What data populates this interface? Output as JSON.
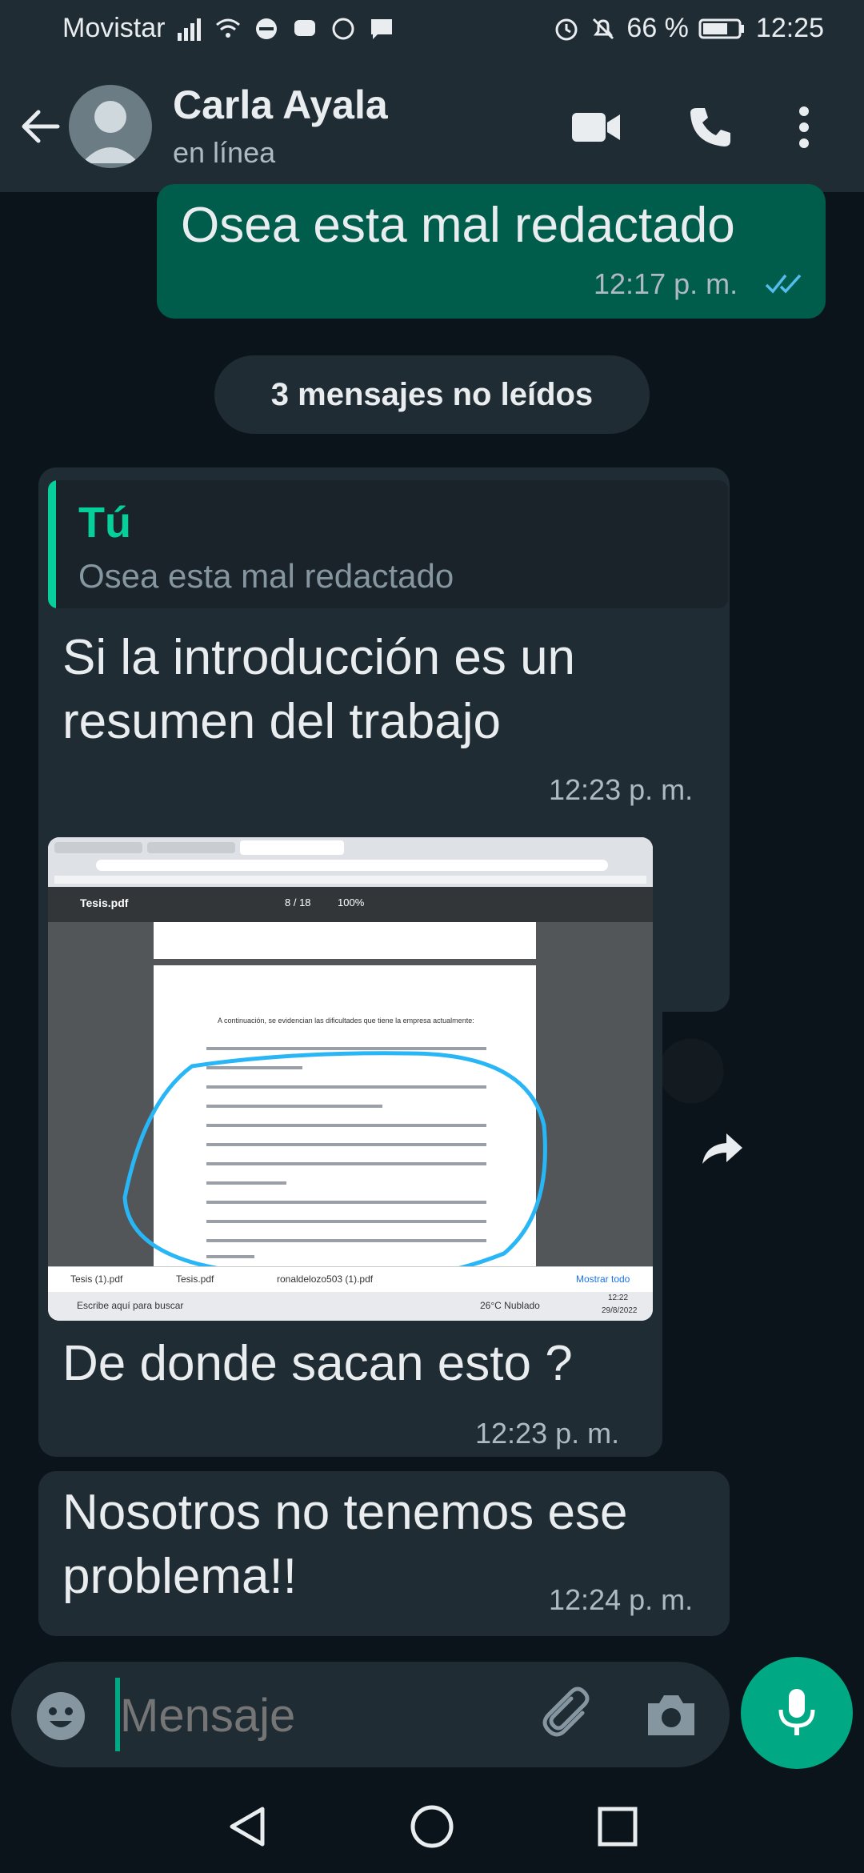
{
  "status_bar": {
    "carrier": "Movistar",
    "battery": "66 %",
    "time": "12:25"
  },
  "header": {
    "contact_name": "Carla Ayala",
    "contact_status": "en línea"
  },
  "messages": {
    "out1": {
      "text": "Osea esta mal redactado",
      "time": "12:17 p. m."
    },
    "unread_label": "3 mensajes no leídos",
    "in1": {
      "quote_author": "Tú",
      "quote_text": "Osea esta mal redactado",
      "text_line1": "Si la introducción es un",
      "text_line2": "resumen del trabajo",
      "time": "12:23 p. m."
    },
    "in2": {
      "caption": "De donde sacan esto ?",
      "time": "12:23 p. m."
    },
    "in3": {
      "text_line1": "Nosotros no tenemos ese",
      "text_line2": "problema!!",
      "time": "12:24 p. m."
    }
  },
  "image_preview": {
    "pdf_title": "Tesis.pdf",
    "page_indicator": "8 / 18",
    "zoom": "100%",
    "para_intro": "A continuación, se evidencian las dificultades que tiene la empresa actualmente:",
    "download1": "Tesis (1).pdf",
    "download2": "Tesis.pdf",
    "download3": "ronaldelozo503 (1).pdf",
    "show_all": "Mostrar todo",
    "search_placeholder": "Escribe aquí para buscar",
    "weather": "26°C Nublado",
    "tb_time": "12:22",
    "tb_date": "29/8/2022"
  },
  "composer": {
    "placeholder": "Mensaje"
  },
  "colors": {
    "outgoing_bubble": "#005c4b",
    "incoming_bubble": "#202c33",
    "accent": "#00a884",
    "read_ticks": "#53bdeb",
    "highlight_circle": "#29b6f6"
  }
}
